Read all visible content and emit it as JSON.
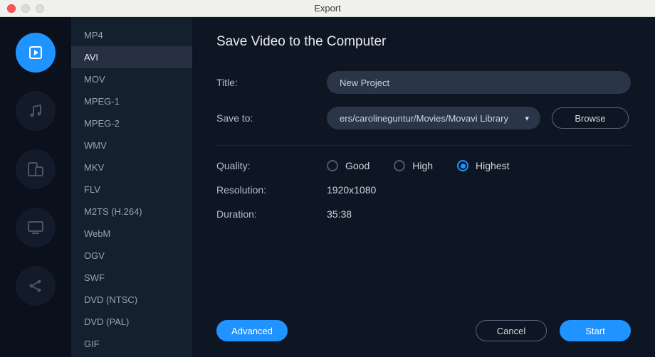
{
  "window": {
    "title": "Export"
  },
  "rail": {
    "active": 0
  },
  "formats": {
    "items": [
      "MP4",
      "AVI",
      "MOV",
      "MPEG-1",
      "MPEG-2",
      "WMV",
      "MKV",
      "FLV",
      "M2TS (H.264)",
      "WebM",
      "OGV",
      "SWF",
      "DVD (NTSC)",
      "DVD (PAL)",
      "GIF"
    ],
    "selected_index": 1
  },
  "panel": {
    "heading": "Save Video to the Computer",
    "labels": {
      "title": "Title:",
      "saveto": "Save to:",
      "quality": "Quality:",
      "resolution": "Resolution:",
      "duration": "Duration:"
    },
    "title_value": "New Project",
    "saveto_path": "ers/carolineguntur/Movies/Movavi Library",
    "browse": "Browse",
    "resolution": "1920x1080",
    "duration": "35:38",
    "quality": {
      "options": [
        "Good",
        "High",
        "Highest"
      ],
      "selected_index": 2
    },
    "buttons": {
      "advanced": "Advanced",
      "cancel": "Cancel",
      "start": "Start"
    }
  }
}
